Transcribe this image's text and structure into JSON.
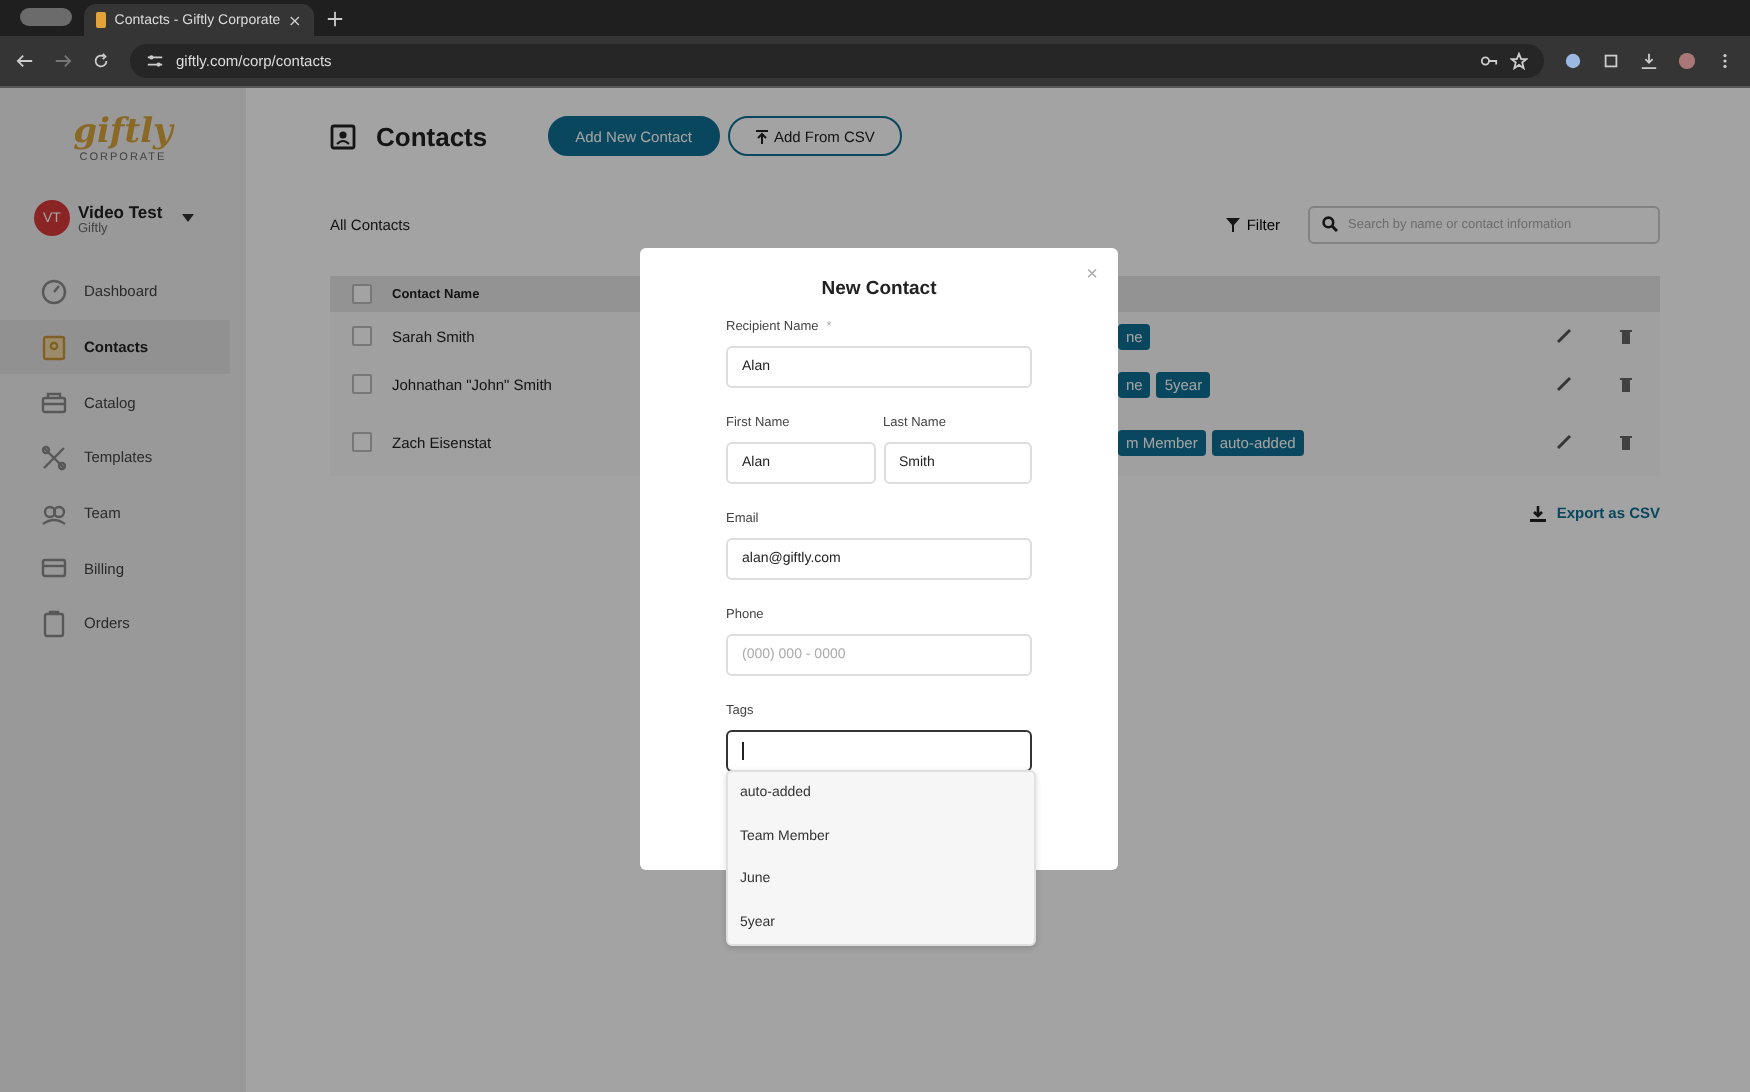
{
  "browser": {
    "tab_title": "Contacts - Giftly Corporate",
    "url": "giftly.com/corp/contacts"
  },
  "sidebar": {
    "logo": "giftly",
    "logo_subtitle": "CORPORATE",
    "user": {
      "initials": "VT",
      "name": "Video Test",
      "org": "Giftly"
    },
    "items": [
      {
        "label": "Dashboard",
        "selected": false
      },
      {
        "label": "Contacts",
        "selected": true
      },
      {
        "label": "Catalog",
        "selected": false
      },
      {
        "label": "Templates",
        "selected": false
      },
      {
        "label": "Team",
        "selected": false
      },
      {
        "label": "Billing",
        "selected": false
      },
      {
        "label": "Orders",
        "selected": false
      }
    ]
  },
  "header": {
    "title": "Contacts",
    "buttons": [
      "Add New Contact",
      "Add From CSV"
    ]
  },
  "toolbar": {
    "section": "All Contacts",
    "filter": "Filter",
    "search": {
      "placeholder": "Search by name or contact information"
    }
  },
  "table": {
    "select_all_checked": false,
    "columns": [
      "Contact Name"
    ],
    "rows": [
      {
        "name": "Sarah Smith",
        "checked": false,
        "tags": [
          "ne"
        ]
      },
      {
        "name": "Johnathan \"John\" Smith",
        "checked": false,
        "tags": [
          "ne",
          "5year"
        ]
      },
      {
        "name": "Zach Eisenstat",
        "checked": false,
        "tags": [
          "m Member",
          "auto-added"
        ]
      }
    ]
  },
  "export": "Export as CSV",
  "modal": {
    "title": "New Contact",
    "close": "×",
    "recipient_name": {
      "label": "Recipient Name",
      "required_mark": "*",
      "value": "Alan"
    },
    "first_name": {
      "label": "First Name",
      "value": "Alan"
    },
    "last_name": {
      "label": "Last Name",
      "value": "Smith"
    },
    "email": {
      "label": "Email",
      "value": "alan@giftly.com"
    },
    "phone": {
      "label": "Phone",
      "placeholder": "(000) 000 - 0000"
    },
    "tags": {
      "label": "Tags",
      "focused": true,
      "options": [
        "auto-added",
        "Team Member",
        "June",
        "5year"
      ]
    }
  }
}
